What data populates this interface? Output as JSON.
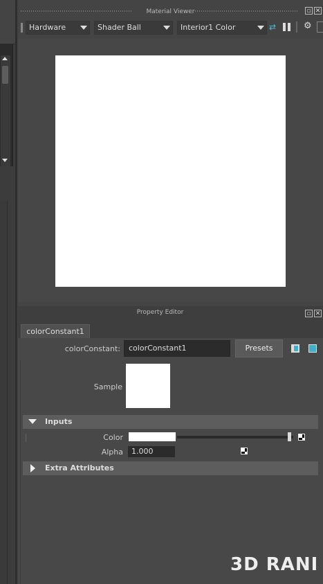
{
  "material_viewer": {
    "title": "Material Viewer",
    "renderer": "Hardware",
    "geometry": "Shader Ball",
    "environment": "Interior1 Color",
    "preview_color": "#ffffff"
  },
  "property_editor": {
    "title": "Property Editor",
    "tab_label": "colorConstant1",
    "node_type_label": "colorConstant:",
    "node_name_value": "colorConstant1",
    "presets_label": "Presets",
    "sample_label": "Sample",
    "inputs_section": {
      "label": "Inputs",
      "color_label": "Color",
      "color_value": "#ffffff",
      "color_slider_fraction": 1.0,
      "alpha_label": "Alpha",
      "alpha_value": "1.000"
    },
    "extra_attributes_label": "Extra Attributes"
  },
  "watermark": "3D RANI",
  "colors": {
    "panel_bg": "#444444",
    "section_bg": "#5d5d5d",
    "field_bg": "#2b2b2b",
    "accent_icon": "#3fb0c9"
  }
}
